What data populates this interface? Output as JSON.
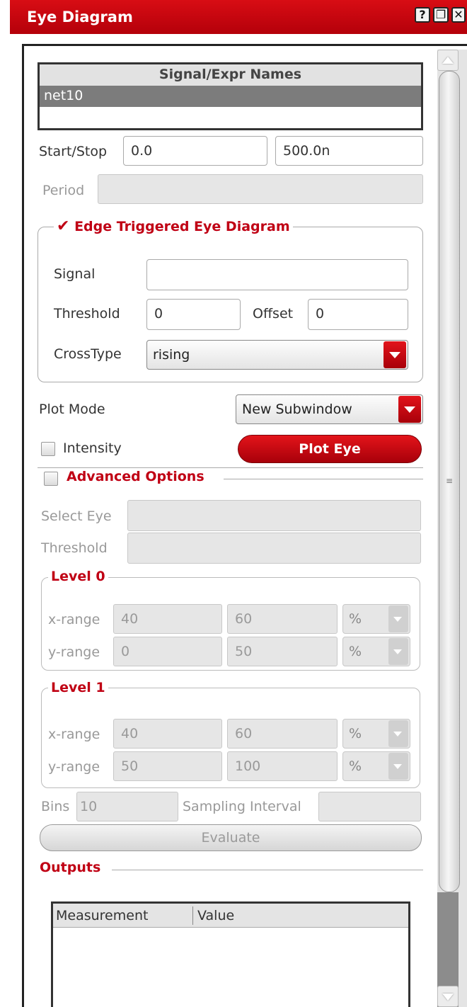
{
  "window": {
    "title": "Eye Diagram",
    "buttons": [
      "?",
      "❐",
      "✕"
    ]
  },
  "signal_list": {
    "header": "Signal/Expr Names",
    "rows": [
      "net10"
    ]
  },
  "start_stop": {
    "label": "Start/Stop",
    "start": "0.0",
    "stop": "500.0n"
  },
  "period": {
    "label": "Period",
    "value": ""
  },
  "edge_triggered": {
    "title": "Edge Triggered Eye Diagram",
    "checked": true,
    "signal_label": "Signal",
    "signal_value": "",
    "threshold_label": "Threshold",
    "threshold_value": "0",
    "offset_label": "Offset",
    "offset_value": "0",
    "crosstype_label": "CrossType",
    "crosstype_value": "rising"
  },
  "plot_mode": {
    "label": "Plot Mode",
    "value": "New Subwindow"
  },
  "intensity": {
    "label": "Intensity",
    "checked": false
  },
  "plot_eye_label": "Plot Eye",
  "advanced": {
    "title": "Advanced Options",
    "checked": false,
    "select_eye_label": "Select Eye",
    "threshold_label": "Threshold",
    "levels": [
      {
        "title": "Level 0",
        "x_label": "x-range",
        "x_min": "40",
        "x_max": "60",
        "x_unit": "%",
        "y_label": "y-range",
        "y_min": "0",
        "y_max": "50",
        "y_unit": "%"
      },
      {
        "title": "Level 1",
        "x_label": "x-range",
        "x_min": "40",
        "x_max": "60",
        "x_unit": "%",
        "y_label": "y-range",
        "y_min": "50",
        "y_max": "100",
        "y_unit": "%"
      }
    ],
    "bins_label": "Bins",
    "bins_value": "10",
    "sampling_label": "Sampling Interval",
    "sampling_value": "",
    "evaluate_label": "Evaluate"
  },
  "outputs": {
    "title": "Outputs",
    "columns": [
      "Measurement",
      "Value"
    ]
  },
  "colors": {
    "accent": "#c00014",
    "title_bar": "#c4000a",
    "selected_row": "#7c7c7c",
    "disabled_field": "#e6e6e6"
  }
}
